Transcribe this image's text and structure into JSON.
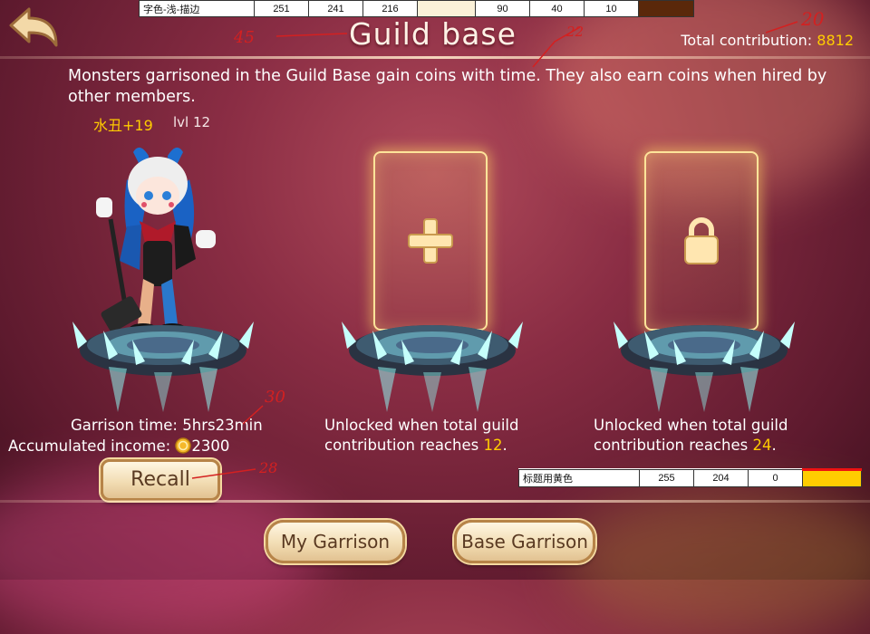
{
  "ref_top": {
    "label": "字色-浅-描边",
    "r": "251",
    "g": "241",
    "b": "216",
    "r2": "90",
    "g2": "40",
    "b2": "10",
    "swatch1": "#fbf1d8",
    "swatch2": "#5a280a"
  },
  "ref_bottom": {
    "label": "标题用黄色",
    "r": "255",
    "g": "204",
    "b": "0",
    "swatch": "#ffcc00"
  },
  "header": {
    "title": "Guild base",
    "contribution_label": "Total contribution:",
    "contribution_value": "8812"
  },
  "description": "Monsters garrisoned in the Guild Base gain coins with time. They also earn coins when hired by other members.",
  "monster": {
    "name": "水丑+19",
    "level": "lvl 12"
  },
  "slot1": {
    "garrison_label": "Garrison time:",
    "garrison_value": "5hrs23min",
    "income_label": "Accumulated income:",
    "income_value": "2300",
    "recall_label": "Recall"
  },
  "slot2": {
    "line1": "Unlocked when total guild",
    "line2_prefix": "contribution reaches",
    "value": "12",
    "suffix": "."
  },
  "slot3": {
    "line1": "Unlocked when total guild",
    "line2_prefix": "contribution reaches",
    "value": "24",
    "suffix": "."
  },
  "footer": {
    "my_garrison": "My Garrison",
    "base_garrison": "Base Garrison"
  },
  "annotations": {
    "a1": "45",
    "a2": "22",
    "a3": "20",
    "a4": "30",
    "a5": "28"
  },
  "colors": {
    "highlight": "#ffcc00",
    "text": "#fbf1d8",
    "outline": "#5a280a"
  }
}
